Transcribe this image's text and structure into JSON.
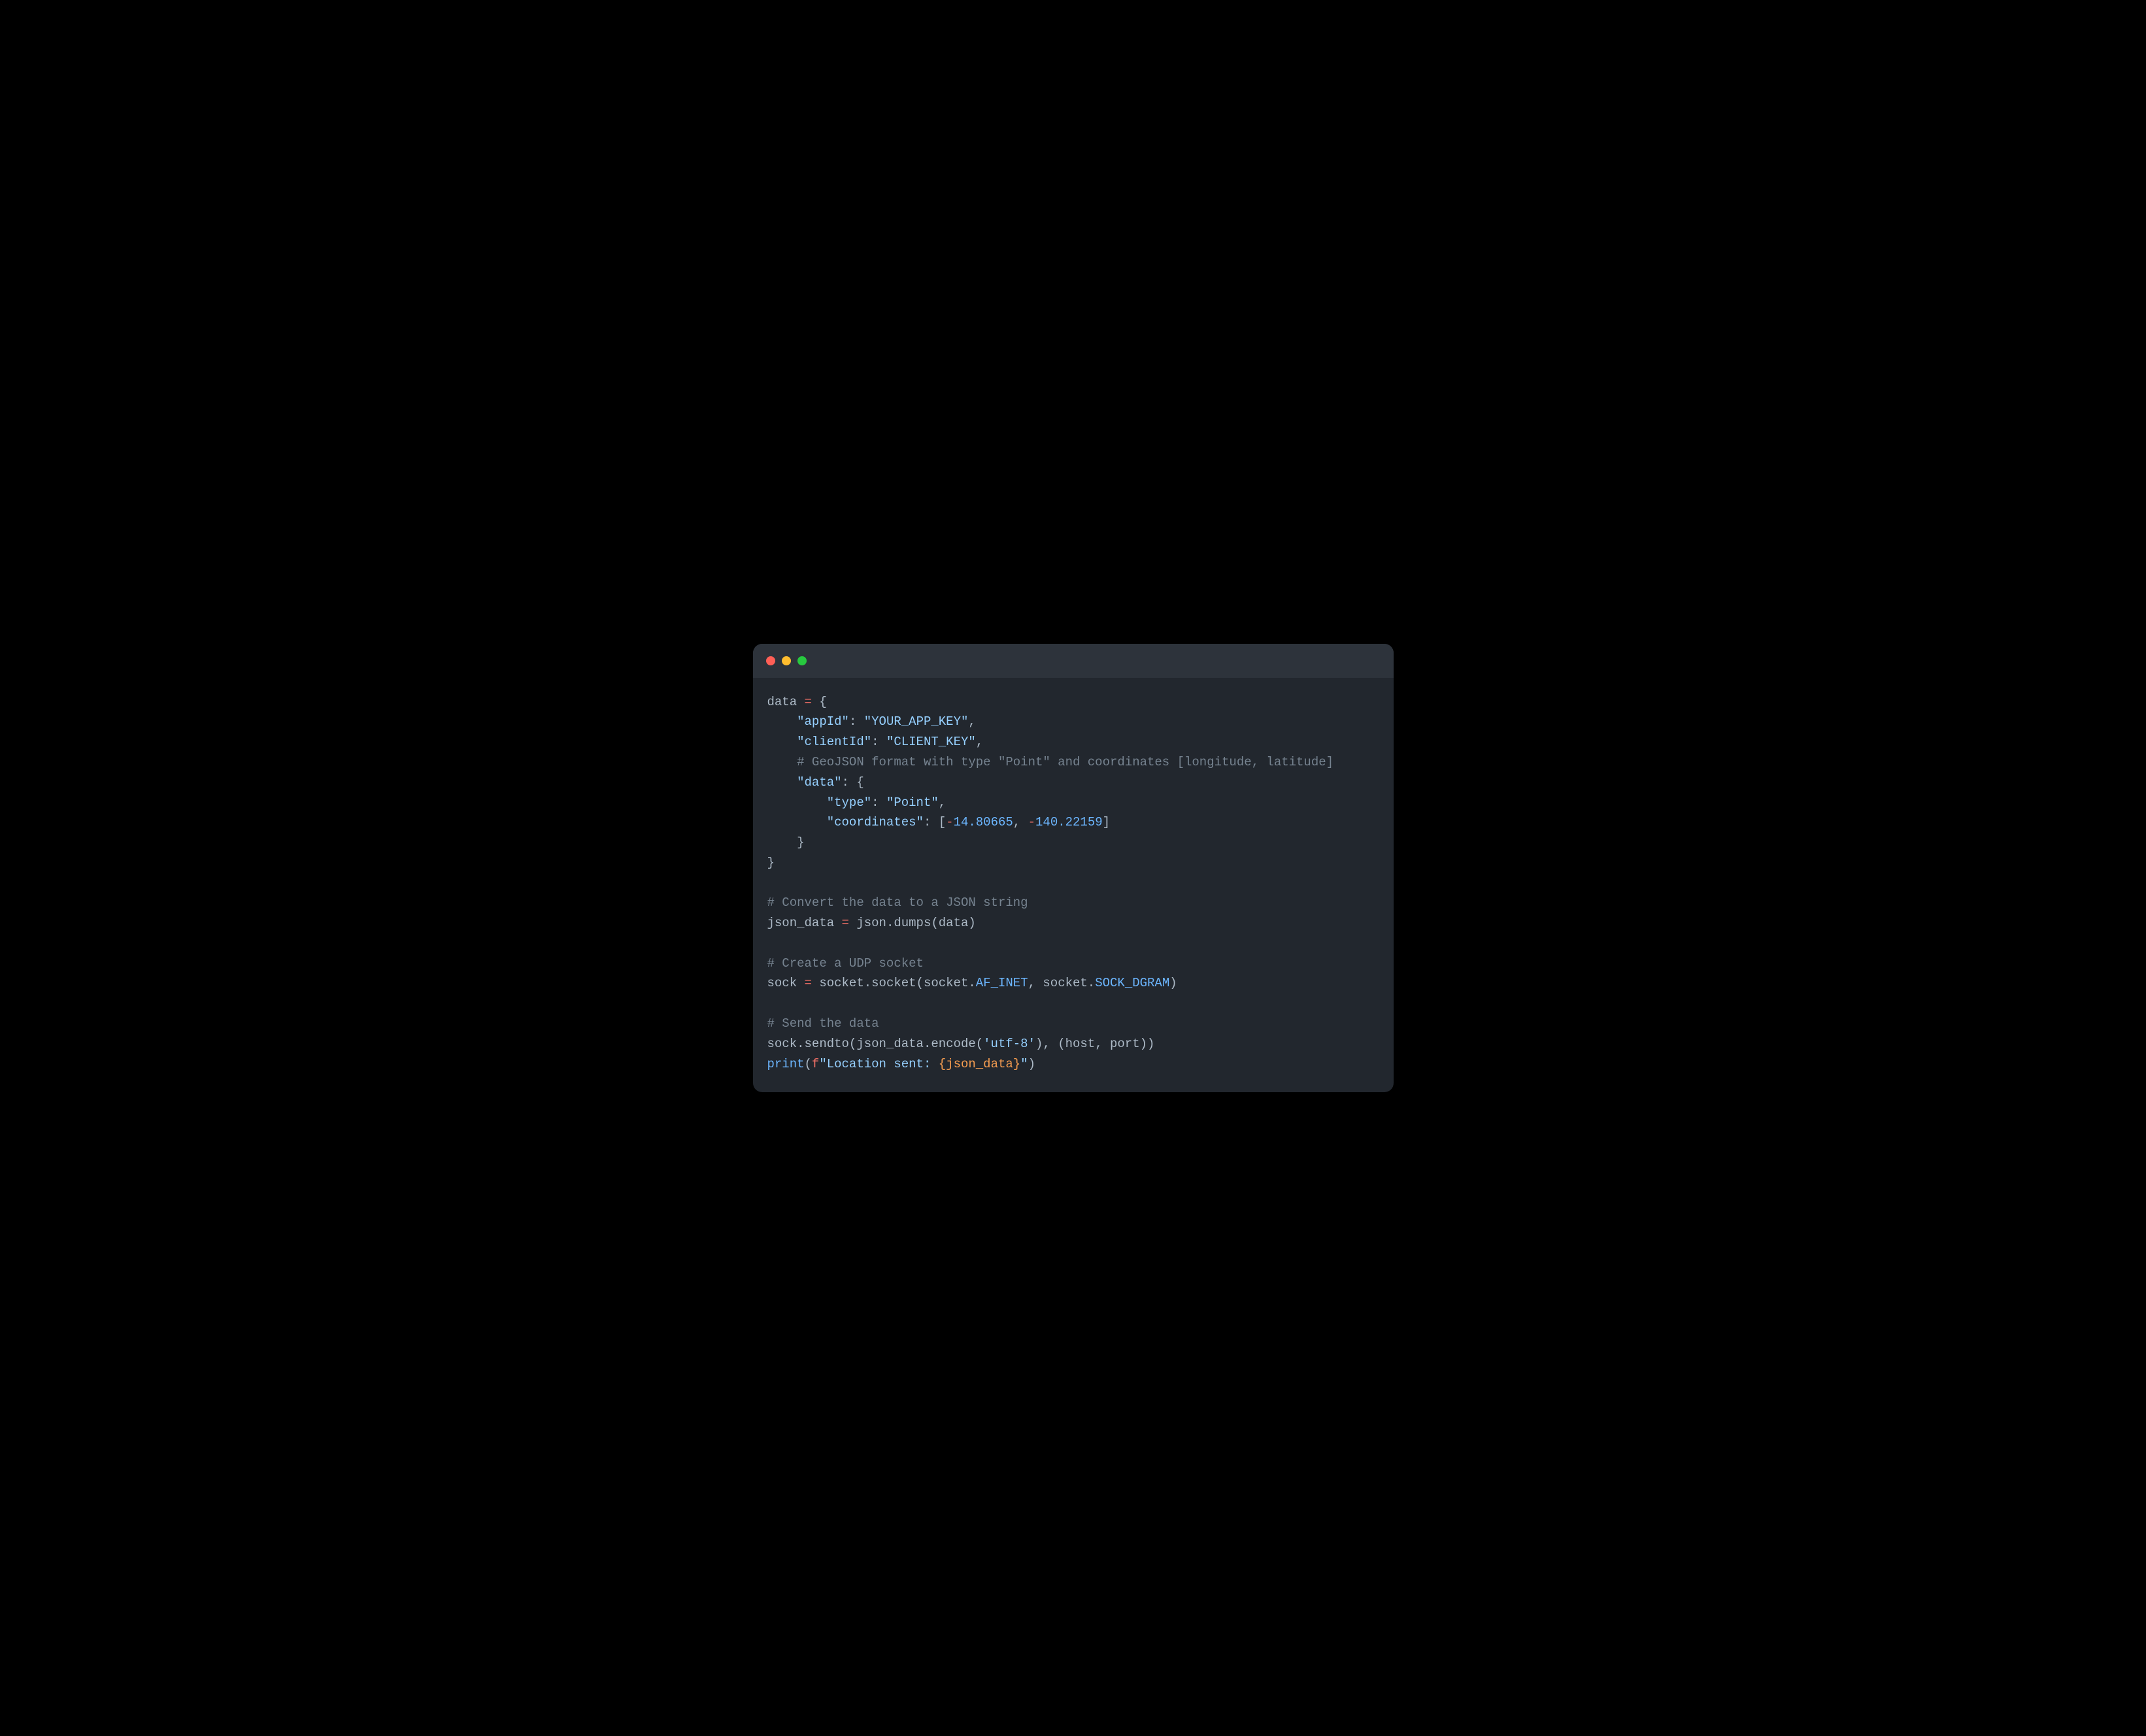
{
  "code": {
    "tokens": [
      [
        [
          "",
          "data "
        ],
        [
          "kw",
          "="
        ],
        [
          "",
          " {"
        ]
      ],
      [
        [
          "",
          "    "
        ],
        [
          "str",
          "\"appId\""
        ],
        [
          "",
          ": "
        ],
        [
          "str",
          "\"YOUR_APP_KEY\""
        ],
        [
          "",
          ","
        ]
      ],
      [
        [
          "",
          "    "
        ],
        [
          "str",
          "\"clientId\""
        ],
        [
          "",
          ": "
        ],
        [
          "str",
          "\"CLIENT_KEY\""
        ],
        [
          "",
          ","
        ]
      ],
      [
        [
          "",
          "    "
        ],
        [
          "com",
          "# GeoJSON format with type \"Point\" and coordinates [longitude, latitude]"
        ]
      ],
      [
        [
          "",
          "    "
        ],
        [
          "str",
          "\"data\""
        ],
        [
          "",
          ": {"
        ]
      ],
      [
        [
          "",
          "        "
        ],
        [
          "str",
          "\"type\""
        ],
        [
          "",
          ": "
        ],
        [
          "str",
          "\"Point\""
        ],
        [
          "",
          ","
        ]
      ],
      [
        [
          "",
          "        "
        ],
        [
          "str",
          "\"coordinates\""
        ],
        [
          "",
          ": ["
        ],
        [
          "kw",
          "-"
        ],
        [
          "const",
          "14.80665"
        ],
        [
          "",
          ", "
        ],
        [
          "kw",
          "-"
        ],
        [
          "const",
          "140.22159"
        ],
        [
          "",
          "]"
        ]
      ],
      [
        [
          "",
          "    }"
        ]
      ],
      [
        [
          "",
          "}"
        ]
      ],
      [
        [
          "",
          ""
        ]
      ],
      [
        [
          "com",
          "# Convert the data to a JSON string"
        ]
      ],
      [
        [
          "",
          "json_data "
        ],
        [
          "kw",
          "="
        ],
        [
          "",
          " json.dumps(data)"
        ]
      ],
      [
        [
          "",
          ""
        ]
      ],
      [
        [
          "com",
          "# Create a UDP socket"
        ]
      ],
      [
        [
          "",
          "sock "
        ],
        [
          "kw",
          "="
        ],
        [
          "",
          " socket.socket(socket."
        ],
        [
          "const",
          "AF_INET"
        ],
        [
          "",
          ", socket."
        ],
        [
          "const",
          "SOCK_DGRAM"
        ],
        [
          "",
          ")"
        ]
      ],
      [
        [
          "",
          ""
        ]
      ],
      [
        [
          "com",
          "# Send the data"
        ]
      ],
      [
        [
          "",
          "sock.sendto(json_data.encode("
        ],
        [
          "str",
          "'utf-8'"
        ],
        [
          "",
          ")"
        ],
        [
          "",
          ", (host, port))"
        ]
      ],
      [
        [
          "builtin",
          "print"
        ],
        [
          "",
          "("
        ],
        [
          "kw",
          "f"
        ],
        [
          "str",
          "\"Location sent: "
        ],
        [
          "fstr-var",
          "{json_data}"
        ],
        [
          "str",
          "\""
        ],
        [
          "",
          ")"
        ]
      ]
    ]
  }
}
